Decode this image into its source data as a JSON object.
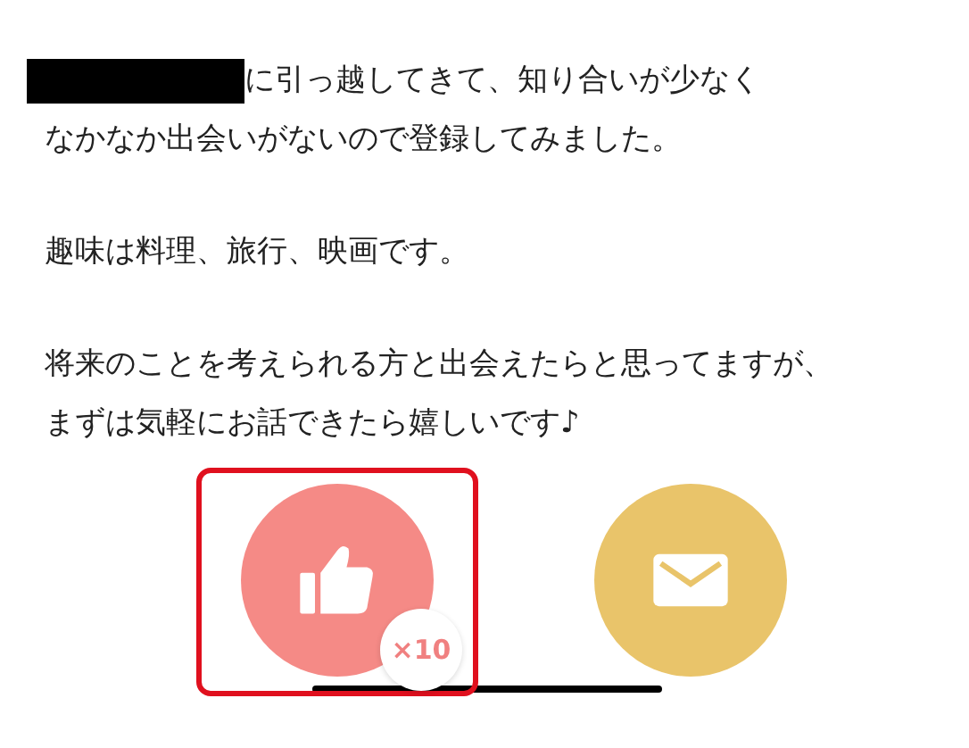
{
  "profile_text": [
    {
      "redacted": true,
      "lines": [
        "に引っ越してきて、知り合いが少なく",
        "なかなか出会いがないので登録してみました。"
      ]
    },
    {
      "redacted": false,
      "lines": [
        "趣味は料理、旅行、映画です。"
      ]
    },
    {
      "redacted": false,
      "lines": [
        "将来のことを考えられる方と出会えたらと思ってますが、",
        "まずは気軽にお話できたら嬉しいです♪"
      ]
    }
  ],
  "actions": [
    {
      "kind": "like",
      "highlighted": true,
      "badge": "×10"
    },
    {
      "kind": "message",
      "highlighted": false
    }
  ]
}
